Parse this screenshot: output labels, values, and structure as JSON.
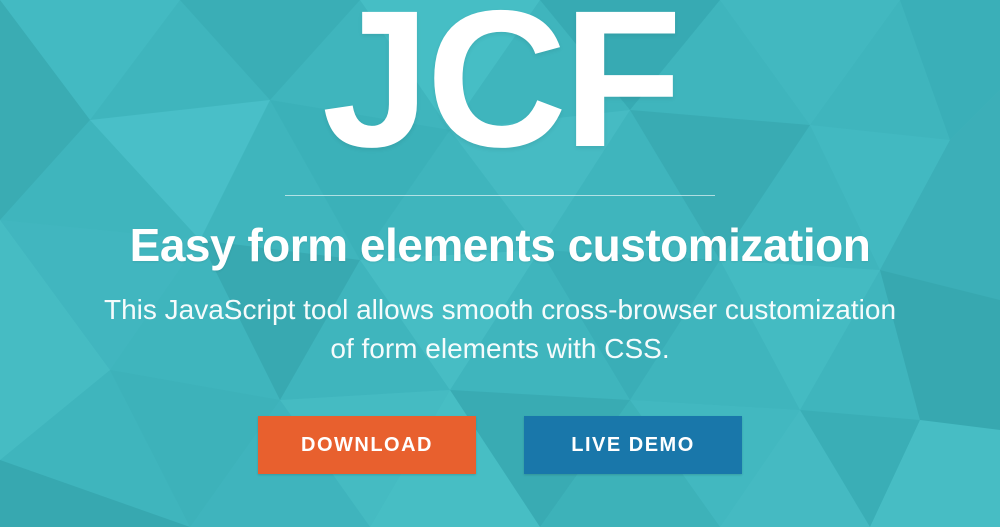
{
  "hero": {
    "logo": "JCF",
    "tagline": "Easy form elements customization",
    "description": "This JavaScript tool allows smooth cross-browser customization of form elements with CSS."
  },
  "buttons": {
    "download_label": "DOWNLOAD",
    "demo_label": "LIVE DEMO"
  },
  "colors": {
    "bg_base": "#3fb5bd",
    "primary_button": "#e8602e",
    "secondary_button": "#1977aa"
  }
}
